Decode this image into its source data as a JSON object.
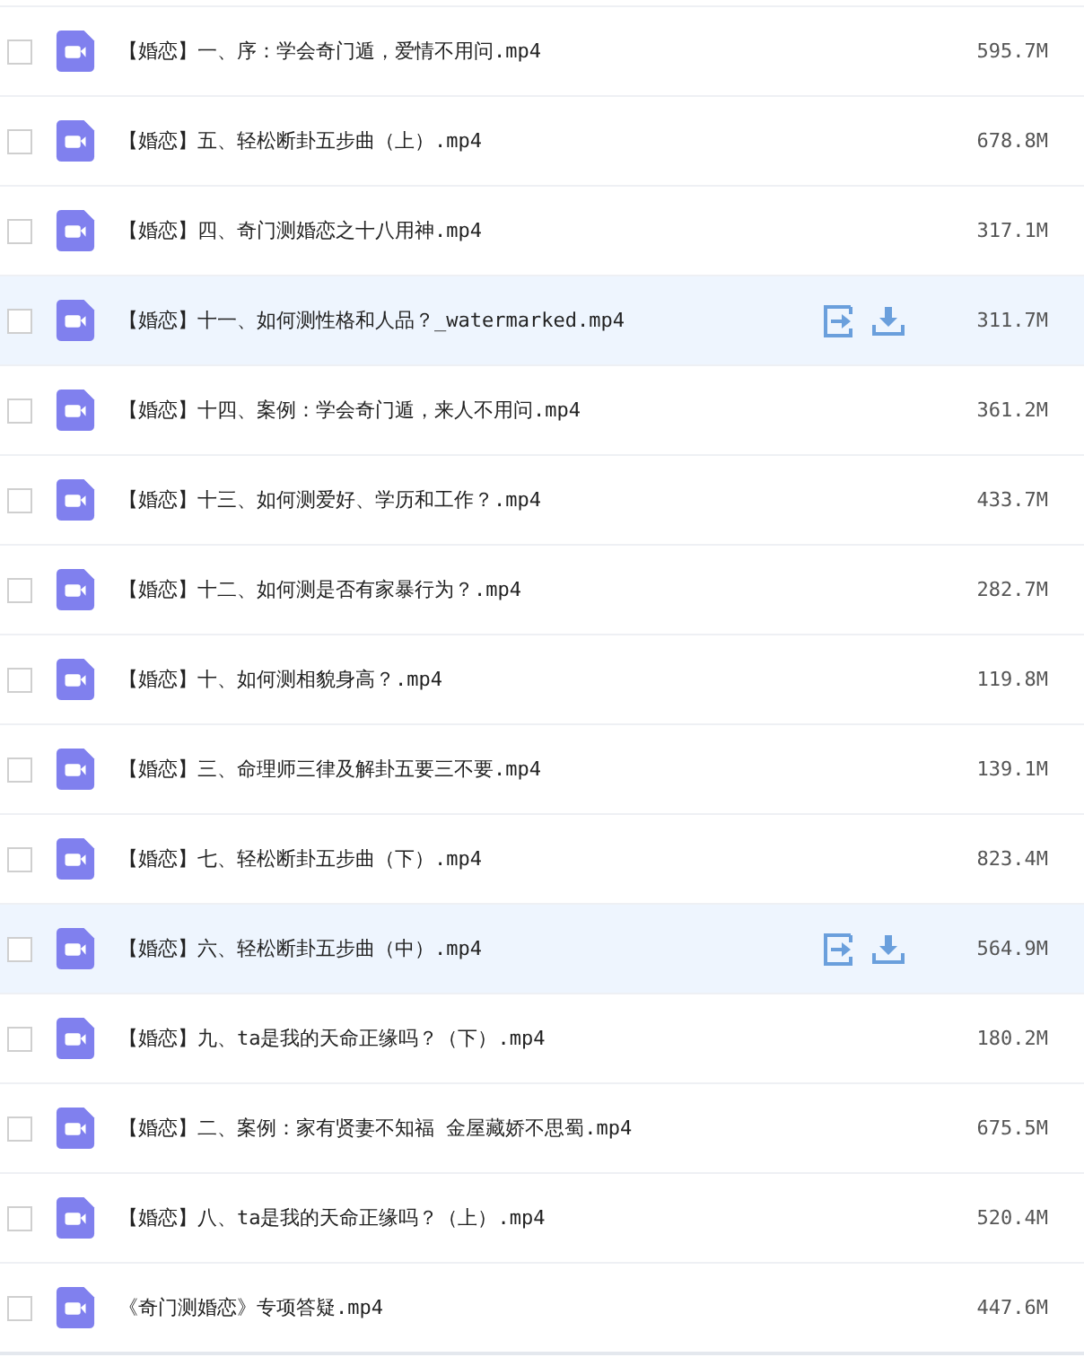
{
  "files": [
    {
      "name": "【婚恋】一、序：学会奇门遁，爱情不用问.mp4",
      "size": "595.7M",
      "checked": false,
      "highlighted": false
    },
    {
      "name": "【婚恋】五、轻松断卦五步曲（上）.mp4",
      "size": "678.8M",
      "checked": false,
      "highlighted": false
    },
    {
      "name": "【婚恋】四、奇门测婚恋之十八用神.mp4",
      "size": "317.1M",
      "checked": false,
      "highlighted": false
    },
    {
      "name": "【婚恋】十一、如何测性格和人品？_watermarked.mp4",
      "size": "311.7M",
      "checked": false,
      "highlighted": true
    },
    {
      "name": "【婚恋】十四、案例：学会奇门遁，来人不用问.mp4",
      "size": "361.2M",
      "checked": false,
      "highlighted": false
    },
    {
      "name": "【婚恋】十三、如何测爱好、学历和工作？.mp4",
      "size": "433.7M",
      "checked": false,
      "highlighted": false
    },
    {
      "name": "【婚恋】十二、如何测是否有家暴行为？.mp4",
      "size": "282.7M",
      "checked": false,
      "highlighted": false
    },
    {
      "name": "【婚恋】十、如何测相貌身高？.mp4",
      "size": "119.8M",
      "checked": false,
      "highlighted": false
    },
    {
      "name": "【婚恋】三、命理师三律及解卦五要三不要.mp4",
      "size": "139.1M",
      "checked": false,
      "highlighted": false
    },
    {
      "name": "【婚恋】七、轻松断卦五步曲（下）.mp4",
      "size": "823.4M",
      "checked": false,
      "highlighted": false
    },
    {
      "name": "【婚恋】六、轻松断卦五步曲（中）.mp4",
      "size": "564.9M",
      "checked": false,
      "highlighted": true
    },
    {
      "name": "【婚恋】九、ta是我的天命正缘吗？（下）.mp4",
      "size": "180.2M",
      "checked": false,
      "highlighted": false
    },
    {
      "name": "【婚恋】二、案例：家有贤妻不知福 金屋藏娇不思蜀.mp4",
      "size": "675.5M",
      "checked": false,
      "highlighted": false
    },
    {
      "name": "【婚恋】八、ta是我的天命正缘吗？（上）.mp4",
      "size": "520.4M",
      "checked": false,
      "highlighted": false
    },
    {
      "name": "《奇门测婚恋》专项答疑.mp4",
      "size": "447.6M",
      "checked": false,
      "highlighted": false
    }
  ]
}
